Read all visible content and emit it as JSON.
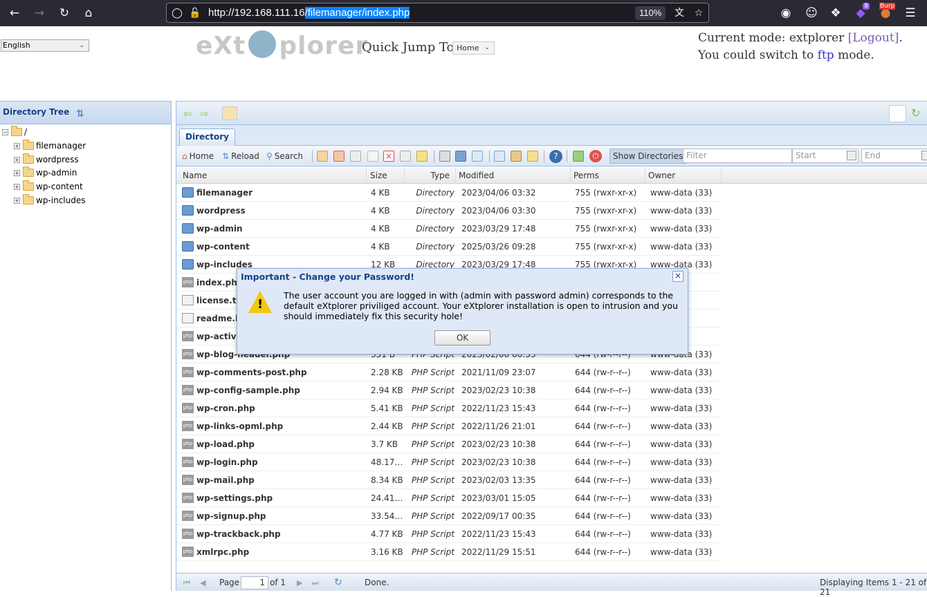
{
  "browser": {
    "url_prefix": "http://192.168.111.16",
    "url_path": "/filemanager/index.php",
    "zoom": "110%",
    "ext_badge": "8",
    "burp_label": "Burp"
  },
  "header": {
    "language": "English",
    "logo_left": "eXt",
    "logo_right": "plorer",
    "quick_jump_label": "Quick Jump To:",
    "quick_jump_value": "Home",
    "mode_prefix": "Current mode: extplorer ",
    "logout": "[Logout]",
    "mode_mid": ". You could switch to ",
    "ftp": "ftp",
    "mode_suffix": " mode."
  },
  "tree": {
    "title": "Directory Tree",
    "root": "/",
    "items": [
      "filemanager",
      "wordpress",
      "wp-admin",
      "wp-content",
      "wp-includes"
    ]
  },
  "tabs": {
    "directory": "Directory"
  },
  "toolbar": {
    "home": "Home",
    "reload": "Reload",
    "search": "Search",
    "show_directories": "Show Directories",
    "filter_placeholder": "Filter",
    "start_placeholder": "Start",
    "end_placeholder": "End"
  },
  "columns": [
    "Name",
    "Size",
    "Type",
    "Modified",
    "Perms",
    "Owner"
  ],
  "rows": [
    {
      "name": "filemanager",
      "size": "4 KB",
      "type": "Directory",
      "modified": "2023/04/06 03:32",
      "perms": "755 (rwxr-xr-x)",
      "owner": "www-data (33)",
      "icon": "dir"
    },
    {
      "name": "wordpress",
      "size": "4 KB",
      "type": "Directory",
      "modified": "2023/04/06 03:30",
      "perms": "755 (rwxr-xr-x)",
      "owner": "www-data (33)",
      "icon": "dir"
    },
    {
      "name": "wp-admin",
      "size": "4 KB",
      "type": "Directory",
      "modified": "2023/03/29 17:48",
      "perms": "755 (rwxr-xr-x)",
      "owner": "www-data (33)",
      "icon": "dir"
    },
    {
      "name": "wp-content",
      "size": "4 KB",
      "type": "Directory",
      "modified": "2025/03/26 09:28",
      "perms": "755 (rwxr-xr-x)",
      "owner": "www-data (33)",
      "icon": "dir"
    },
    {
      "name": "wp-includes",
      "size": "12 KB",
      "type": "Directory",
      "modified": "2023/03/29 17:48",
      "perms": "755 (rwxr-xr-x)",
      "owner": "www-data (33)",
      "icon": "dir"
    },
    {
      "name": "index.php",
      "size": "",
      "type": "",
      "modified": "",
      "perms": "",
      "owner": "(33)",
      "icon": "php"
    },
    {
      "name": "license.txt",
      "size": "",
      "type": "",
      "modified": "",
      "perms": "",
      "owner": "(33)",
      "icon": "txt"
    },
    {
      "name": "readme.ht",
      "size": "",
      "type": "",
      "modified": "",
      "perms": "",
      "owner": "(33)",
      "icon": "txt"
    },
    {
      "name": "wp-activat",
      "size": "",
      "type": "",
      "modified": "",
      "perms": "",
      "owner": "(33)",
      "icon": "php"
    },
    {
      "name": "wp-blog-header.php",
      "size": "351 B",
      "type": "PHP Script",
      "modified": "2023/02/06 00:53",
      "perms": "644 (rw-r--r--)",
      "owner": "www-data (33)",
      "icon": "php"
    },
    {
      "name": "wp-comments-post.php",
      "size": "2.28 KB",
      "type": "PHP Script",
      "modified": "2021/11/09 23:07",
      "perms": "644 (rw-r--r--)",
      "owner": "www-data (33)",
      "icon": "php"
    },
    {
      "name": "wp-config-sample.php",
      "size": "2.94 KB",
      "type": "PHP Script",
      "modified": "2023/02/23 10:38",
      "perms": "644 (rw-r--r--)",
      "owner": "www-data (33)",
      "icon": "php"
    },
    {
      "name": "wp-cron.php",
      "size": "5.41 KB",
      "type": "PHP Script",
      "modified": "2022/11/23 15:43",
      "perms": "644 (rw-r--r--)",
      "owner": "www-data (33)",
      "icon": "php"
    },
    {
      "name": "wp-links-opml.php",
      "size": "2.44 KB",
      "type": "PHP Script",
      "modified": "2022/11/26 21:01",
      "perms": "644 (rw-r--r--)",
      "owner": "www-data (33)",
      "icon": "php"
    },
    {
      "name": "wp-load.php",
      "size": "3.7 KB",
      "type": "PHP Script",
      "modified": "2023/02/23 10:38",
      "perms": "644 (rw-r--r--)",
      "owner": "www-data (33)",
      "icon": "php"
    },
    {
      "name": "wp-login.php",
      "size": "48.17…",
      "type": "PHP Script",
      "modified": "2023/02/23 10:38",
      "perms": "644 (rw-r--r--)",
      "owner": "www-data (33)",
      "icon": "php"
    },
    {
      "name": "wp-mail.php",
      "size": "8.34 KB",
      "type": "PHP Script",
      "modified": "2023/02/03 13:35",
      "perms": "644 (rw-r--r--)",
      "owner": "www-data (33)",
      "icon": "php"
    },
    {
      "name": "wp-settings.php",
      "size": "24.41…",
      "type": "PHP Script",
      "modified": "2023/03/01 15:05",
      "perms": "644 (rw-r--r--)",
      "owner": "www-data (33)",
      "icon": "php"
    },
    {
      "name": "wp-signup.php",
      "size": "33.54…",
      "type": "PHP Script",
      "modified": "2022/09/17 00:35",
      "perms": "644 (rw-r--r--)",
      "owner": "www-data (33)",
      "icon": "php"
    },
    {
      "name": "wp-trackback.php",
      "size": "4.77 KB",
      "type": "PHP Script",
      "modified": "2022/11/23 15:43",
      "perms": "644 (rw-r--r--)",
      "owner": "www-data (33)",
      "icon": "php"
    },
    {
      "name": "xmlrpc.php",
      "size": "3.16 KB",
      "type": "PHP Script",
      "modified": "2022/11/29 15:51",
      "perms": "644 (rw-r--r--)",
      "owner": "www-data (33)",
      "icon": "php"
    }
  ],
  "footer": {
    "page_label": "Page",
    "page_value": "1",
    "of_label": "of 1",
    "status": "Done.",
    "displaying": "Displaying Items 1 - 21 of 21"
  },
  "modal": {
    "title": "Important - Change your Password!",
    "message": "The user account you are logged in with (admin with password admin) corresponds to the default eXtplorer priviliged account. Your eXtplorer installation is open to intrusion and you should immediately fix this security hole!",
    "ok": "OK"
  }
}
